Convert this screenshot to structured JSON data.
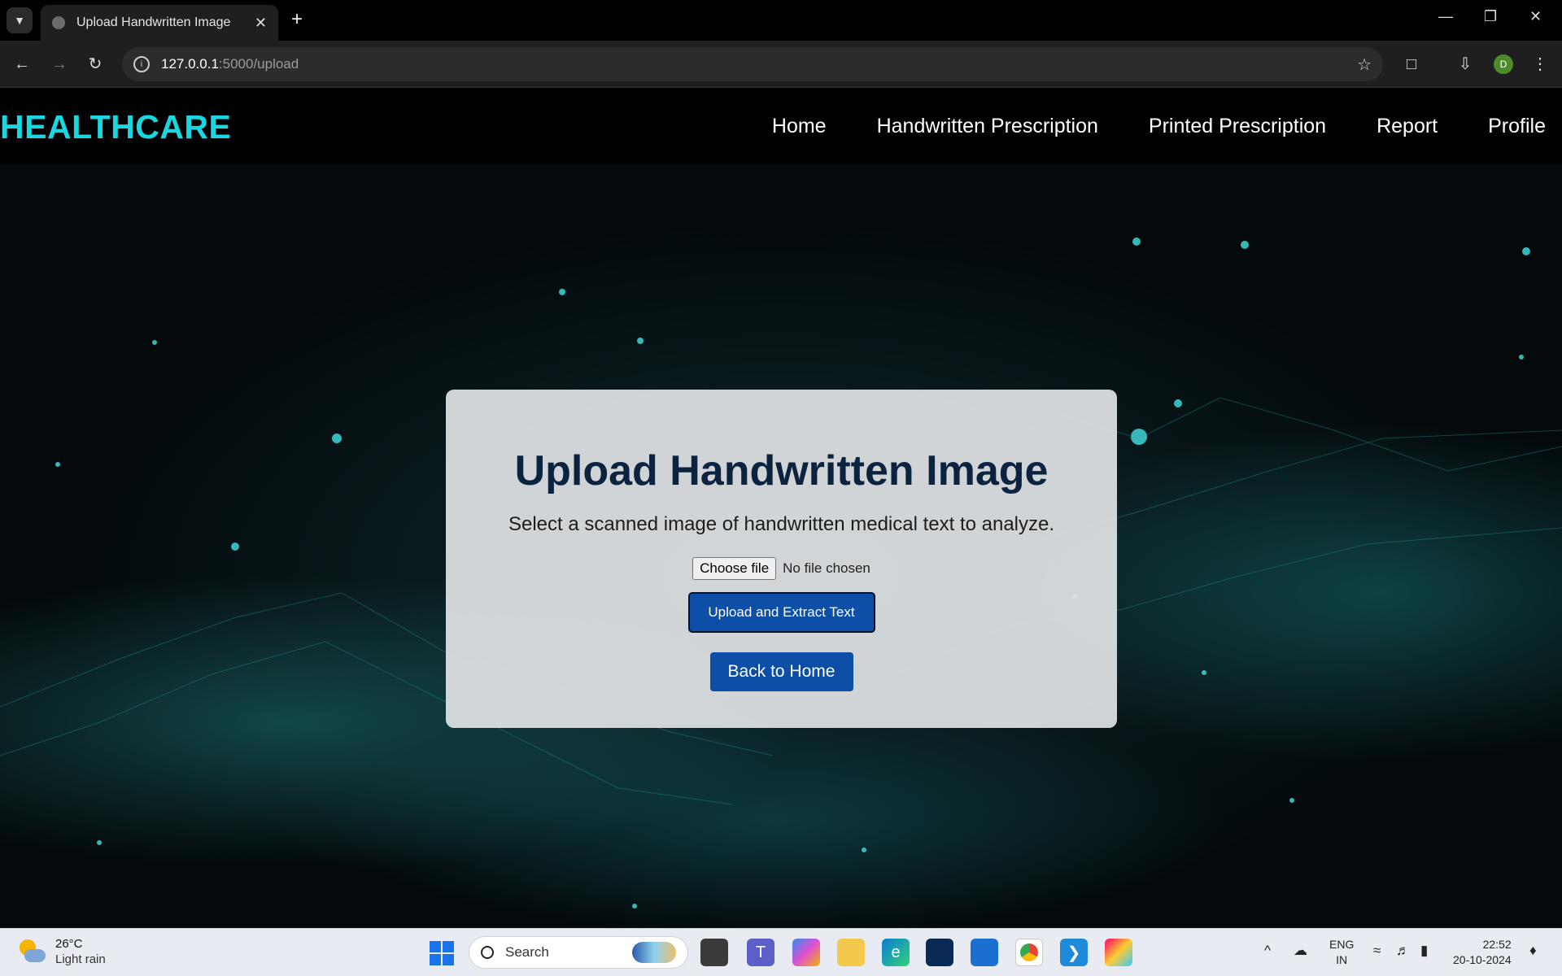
{
  "browser": {
    "tab_title": "Upload Handwritten Image",
    "url_host": "127.0.0.1",
    "url_path": ":5000/upload",
    "profile_initial": "D"
  },
  "site": {
    "brand": "HEALTHCARE",
    "nav": [
      "Home",
      "Handwritten Prescription",
      "Printed Prescription",
      "Report",
      "Profile"
    ]
  },
  "card": {
    "title": "Upload Handwritten Image",
    "subtitle": "Select a scanned image of handwritten medical text to analyze.",
    "choose_file_label": "Choose file",
    "file_status": "No file chosen",
    "upload_button": "Upload and Extract Text",
    "home_button": "Back to Home"
  },
  "taskbar": {
    "temperature": "26°C",
    "weather": "Light rain",
    "search_placeholder": "Search",
    "lang_top": "ENG",
    "lang_bottom": "IN",
    "time": "22:52",
    "date": "20-10-2024"
  }
}
